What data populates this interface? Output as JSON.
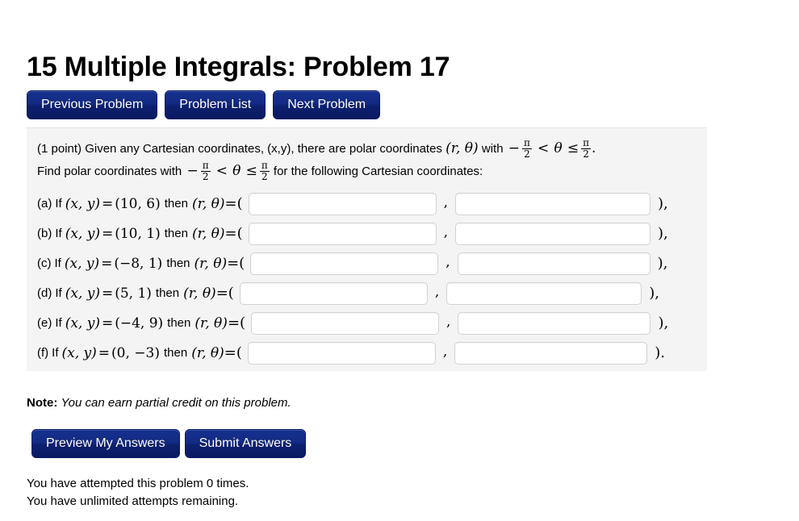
{
  "page_title": "15 Multiple Integrals: Problem 17",
  "nav": {
    "previous_label": "Previous Problem",
    "list_label": "Problem List",
    "next_label": "Next Problem"
  },
  "problem": {
    "points": "(1 point)",
    "statement_line1_part1": "Given any Cartesian coordinates, (x,y), there are polar coordinates",
    "statement_line1_vars": "(r, θ)",
    "statement_line1_with": "with",
    "statement_line1_minus": "−",
    "statement_line1_lt": "<",
    "statement_line1_theta": "θ",
    "statement_line1_le": "≤",
    "statement_line1_period": ".",
    "statement_line2_part1": "Find polar coordinates with",
    "statement_line2_part2": "for the following Cartesian coordinates:",
    "frac_num": "π",
    "frac_den": "2",
    "word_if": "If",
    "word_then": "then",
    "xy_label": "(x, y)",
    "equals": "=",
    "rtheta_label": "(r, θ)",
    "eq_open": "=(",
    "comma": ",",
    "close_comma": "),",
    "close_period": ").",
    "rows": [
      {
        "tag": "(a)",
        "coords": "(10, 6)",
        "r_value": "",
        "theta_value": "",
        "r_width": 233,
        "theta_width": 242,
        "closer": "),"
      },
      {
        "tag": "(b)",
        "coords": "(10, 1)",
        "r_value": "",
        "theta_value": "",
        "r_width": 233,
        "theta_width": 242,
        "closer": "),"
      },
      {
        "tag": "(c)",
        "coords": "(−8, 1)",
        "r_value": "",
        "theta_value": "",
        "r_width": 233,
        "theta_width": 239,
        "closer": "),"
      },
      {
        "tag": "(d)",
        "coords": "(5, 1)",
        "r_value": "",
        "theta_value": "",
        "r_width": 233,
        "theta_width": 242,
        "closer": "),"
      },
      {
        "tag": "(e)",
        "coords": "(−4, 9)",
        "r_value": "",
        "theta_value": "",
        "r_width": 233,
        "theta_width": 239,
        "closer": "),"
      },
      {
        "tag": "(f)",
        "coords": "(0, −3)",
        "r_value": "",
        "theta_value": "",
        "r_width": 233,
        "theta_width": 239,
        "closer": ")."
      }
    ]
  },
  "note": {
    "label": "Note:",
    "text": "You can earn partial credit on this problem."
  },
  "actions": {
    "preview_label": "Preview My Answers",
    "submit_label": "Submit Answers"
  },
  "status": {
    "attempts": "You have attempted this problem 0 times.",
    "remaining": "You have unlimited attempts remaining."
  },
  "input_placeholder": "",
  "colors": {
    "button_navy": "#132b85",
    "panel_bg": "#f4f4f4",
    "input_border": "#d2d2d2"
  }
}
